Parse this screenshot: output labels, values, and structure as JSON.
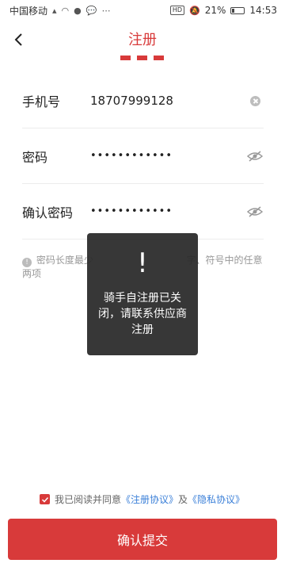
{
  "status_bar": {
    "carrier": "中国移动",
    "battery": "21%",
    "time": "14:53",
    "hd": "HD"
  },
  "header": {
    "title": "注册"
  },
  "form": {
    "phone_label": "手机号",
    "phone_value": "18707999128",
    "password_label": "密码",
    "password_value": "••••••••••••",
    "confirm_label": "确认密码",
    "confirm_value": "••••••••••••"
  },
  "hint": {
    "text_left": "密码长度最少",
    "text_right": "字、符号中的任意两项"
  },
  "toast": {
    "icon": "!",
    "message": "骑手自注册已关闭，请联系供应商注册"
  },
  "agreement": {
    "prefix": "我已阅读并同意",
    "register_link": "《注册协议》",
    "conjunction": "及",
    "privacy_link": "《隐私协议》",
    "checked": true
  },
  "submit": {
    "label": "确认提交"
  },
  "colors": {
    "accent": "#d83a3a",
    "link": "#3a7fd8"
  }
}
